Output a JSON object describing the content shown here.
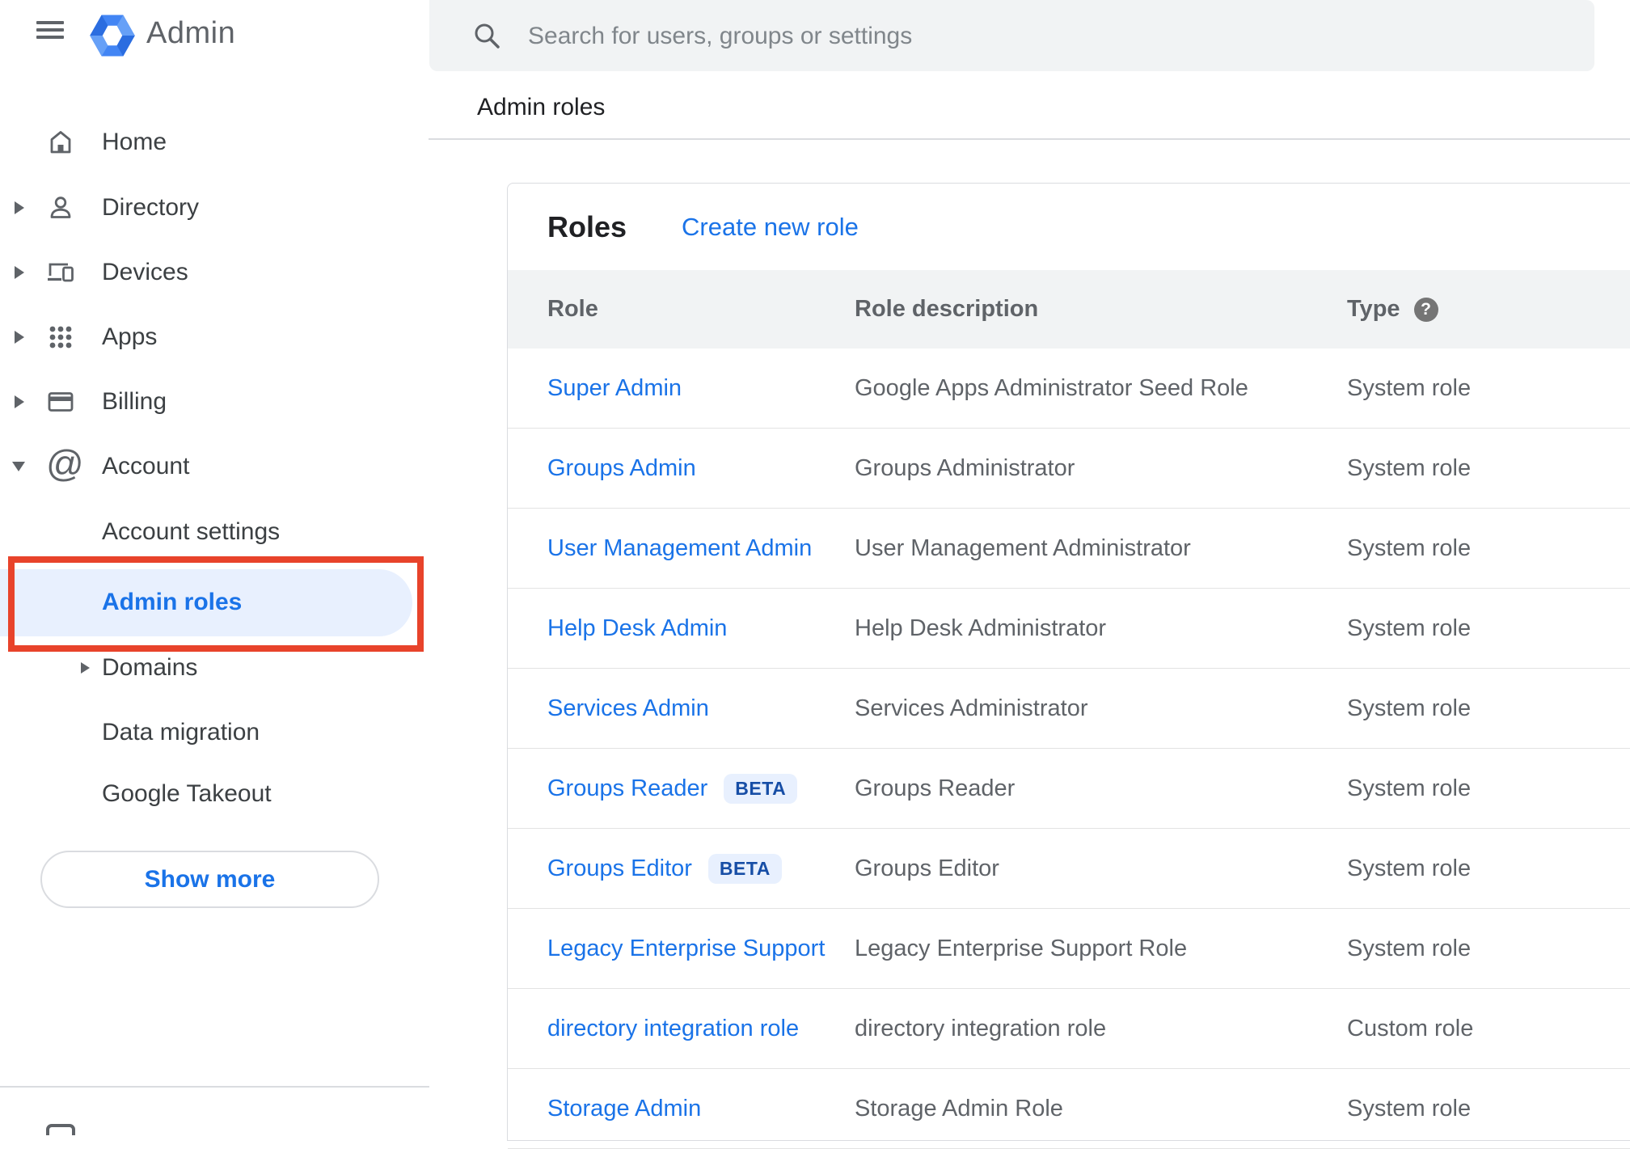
{
  "topbar": {
    "logo_text": "Admin",
    "search_placeholder": "Search for users, groups or settings"
  },
  "breadcrumb": "Admin roles",
  "sidebar": {
    "items": [
      {
        "label": "Home",
        "icon": "home-icon"
      },
      {
        "label": "Directory",
        "icon": "person-icon",
        "arrow": "right"
      },
      {
        "label": "Devices",
        "icon": "devices-icon",
        "arrow": "right"
      },
      {
        "label": "Apps",
        "icon": "apps-grid-icon",
        "arrow": "right"
      },
      {
        "label": "Billing",
        "icon": "credit-card-icon",
        "arrow": "right"
      },
      {
        "label": "Account",
        "icon": "at-sign-icon",
        "arrow": "down",
        "expanded": true
      },
      {
        "label": "Account settings",
        "indent": true
      },
      {
        "label": "Admin roles",
        "indent": true,
        "selected": true,
        "annotated": "red-box"
      },
      {
        "label": "Domains",
        "indent": true,
        "arrow": "right"
      },
      {
        "label": "Data migration",
        "indent": true
      },
      {
        "label": "Google Takeout",
        "indent": true
      }
    ],
    "show_more_label": "Show more"
  },
  "panel": {
    "title": "Roles",
    "create_link": "Create new role",
    "columns": {
      "role": "Role",
      "description": "Role description",
      "type": "Type"
    },
    "help_glyph": "?",
    "rows": [
      {
        "role": "Super Admin",
        "description": "Google Apps Administrator Seed Role",
        "type": "System role"
      },
      {
        "role": "Groups Admin",
        "description": "Groups Administrator",
        "type": "System role"
      },
      {
        "role": "User Management Admin",
        "description": "User Management Administrator",
        "type": "System role"
      },
      {
        "role": "Help Desk Admin",
        "description": "Help Desk Administrator",
        "type": "System role"
      },
      {
        "role": "Services Admin",
        "description": "Services Administrator",
        "type": "System role"
      },
      {
        "role": "Groups Reader",
        "badge": "BETA",
        "description": "Groups Reader",
        "type": "System role"
      },
      {
        "role": "Groups Editor",
        "badge": "BETA",
        "description": "Groups Editor",
        "type": "System role"
      },
      {
        "role": "Legacy Enterprise Support",
        "description": "Legacy Enterprise Support Role",
        "type": "System role"
      },
      {
        "role": "directory integration role",
        "description": "directory integration role",
        "type": "Custom role"
      },
      {
        "role": "Storage Admin",
        "description": "Storage Admin Role",
        "type": "System role"
      }
    ]
  },
  "colors": {
    "link_blue": "#1a73e8",
    "selected_bg": "#e8f0fe",
    "beta_bg": "#e8f0fe",
    "beta_text": "#174ea6",
    "annotation_red": "#e8432b",
    "table_header_bg": "#f1f3f4",
    "divider": "#dadce0",
    "text_primary": "#202124",
    "text_secondary": "#5f6368",
    "logo_blue": "#4285f4"
  }
}
